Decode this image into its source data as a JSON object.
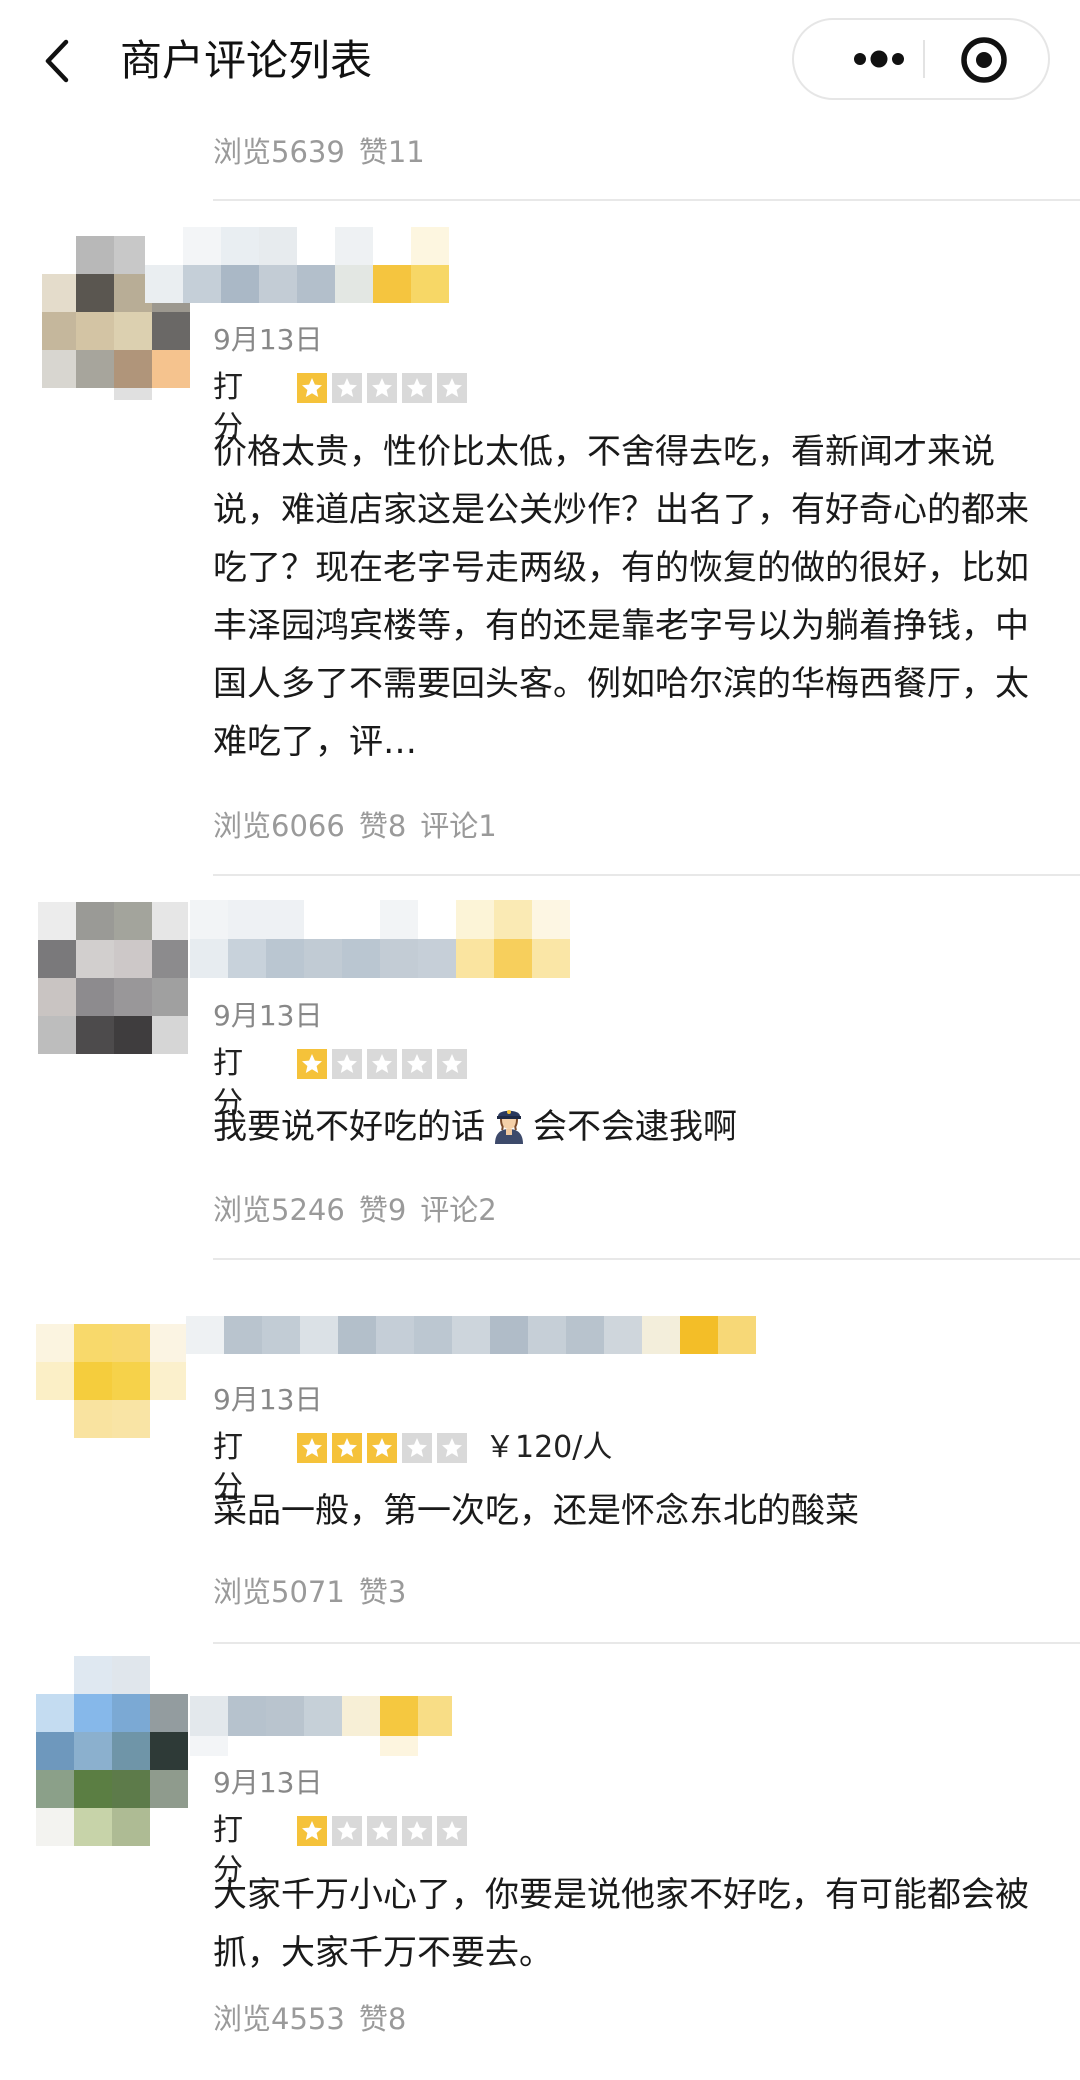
{
  "header": {
    "title": "商户评论列表",
    "back_icon": "chevron-left-icon",
    "more_icon": "more-dots-icon",
    "target_icon": "target-icon"
  },
  "top_stats": {
    "views": "浏览5639",
    "likes": "赞11"
  },
  "score_label": "打分",
  "reviews": [
    {
      "date": "9月13日",
      "rating": 1,
      "content": "价格太贵，性价比太低，不舍得去吃，看新闻才来说说，难道店家这是公关炒作？出名了，有好奇心的都来吃了？现在老字号走两级，有的恢复的做的很好，比如丰泽园鸿宾楼等，有的还是靠老字号以为躺着挣钱，中国人多了不需要回头客。例如哈尔滨的华梅西餐厅，太难吃了，评…",
      "views": "浏览6066",
      "likes": "赞8",
      "comments": "评论1"
    },
    {
      "date": "9月13日",
      "rating": 1,
      "content_before": "我要说不好吃的话",
      "content_emoji": "police-officer-emoji",
      "content_after": "会不会逮我啊",
      "views": "浏览5246",
      "likes": "赞9",
      "comments": "评论2"
    },
    {
      "date": "9月13日",
      "rating": 3,
      "price": "￥120/人",
      "content": "菜品一般，第一次吃，还是怀念东北的酸菜",
      "views": "浏览5071",
      "likes": "赞3"
    },
    {
      "date": "9月13日",
      "rating": 1,
      "content": "大家千万小心了，你要是说他家不好吃，有可能都会被抓，大家千万不要去。",
      "views": "浏览4553",
      "likes": "赞8"
    }
  ],
  "colors": {
    "star_on": "#f5c23a",
    "star_off": "#d9d9d9",
    "meta_text": "#9a9a9a",
    "divider": "#e8e8e8"
  }
}
